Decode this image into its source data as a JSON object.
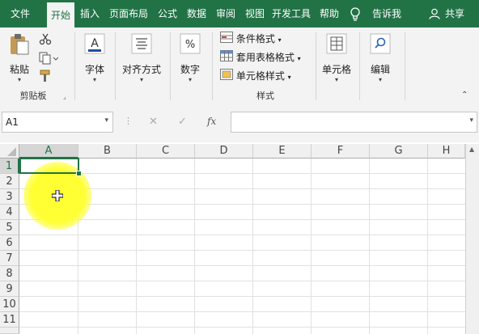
{
  "tabs": [
    {
      "label": "文件"
    },
    {
      "label": "开始"
    },
    {
      "label": "插入"
    },
    {
      "label": "页面布局"
    },
    {
      "label": "公式"
    },
    {
      "label": "数据"
    },
    {
      "label": "审阅"
    },
    {
      "label": "视图"
    },
    {
      "label": "开发工具"
    },
    {
      "label": "帮助"
    }
  ],
  "tellme": "告诉我",
  "share": "共享",
  "ribbon": {
    "clipboard": {
      "paste": "粘贴",
      "group": "剪贴板"
    },
    "font": {
      "label": "字体"
    },
    "align": {
      "label": "对齐方式"
    },
    "number": {
      "label": "数字"
    },
    "styles": {
      "conditional": "条件格式",
      "table": "套用表格格式",
      "cell": "单元格样式",
      "group": "样式"
    },
    "cells": {
      "label": "单元格"
    },
    "editing": {
      "label": "编辑"
    }
  },
  "formula_bar": {
    "name_box": "A1",
    "fx": "fx",
    "content": ""
  },
  "grid": {
    "columns": [
      "A",
      "B",
      "C",
      "D",
      "E",
      "F",
      "G",
      "H"
    ],
    "rows": [
      "1",
      "2",
      "3",
      "4",
      "5",
      "6",
      "7",
      "8",
      "9",
      "10",
      "11"
    ]
  },
  "colors": {
    "accent": "#217346",
    "highlight": "#ffff33"
  }
}
